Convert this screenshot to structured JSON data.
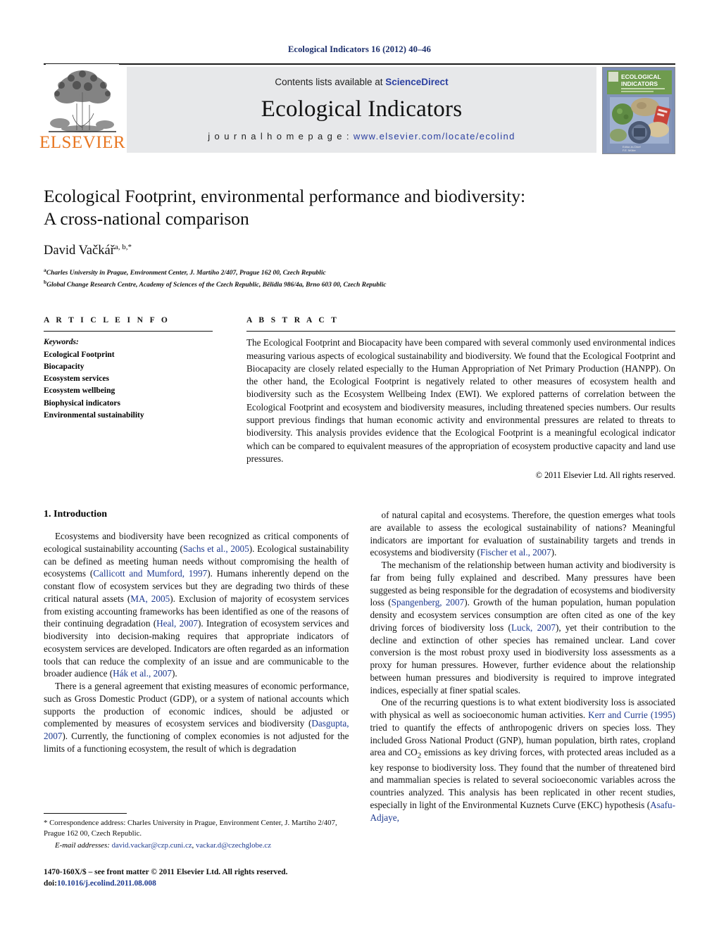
{
  "running_head": "Ecological Indicators 16 (2012) 40–46",
  "masthead": {
    "publisher_wordmark": "ELSEVIER",
    "contents_line_prefix": "Contents lists available at ",
    "contents_line_link": "ScienceDirect",
    "journal_title": "Ecological Indicators",
    "homepage_label": "j o u r n a l   h o m e p a g e :   ",
    "homepage_url": "www.elsevier.com/locate/ecolind",
    "cover": {
      "title_line1": "ECOLOGICAL",
      "title_line2": "INDICATORS",
      "subtitle": "INTEGRATING MONITORING ASSESSMENT AND MANAGEMENT"
    }
  },
  "article": {
    "title_line1": "Ecological Footprint, environmental performance and biodiversity:",
    "title_line2": "A cross-national comparison",
    "author": "David Vačkář",
    "author_marks": "a, b,*",
    "affiliation_a_mark": "a",
    "affiliation_a": "Charles University in Prague, Environment Center, J. Martího 2/407, Prague 162 00, Czech Republic",
    "affiliation_b_mark": "b",
    "affiliation_b": "Global Change Research Centre, Academy of Sciences of the Czech Republic, Bělidla 986/4a, Brno 603 00, Czech Republic"
  },
  "article_info": {
    "heading": "A R T I C L E   I N F O",
    "keywords_label": "Keywords:",
    "keywords": [
      "Ecological Footprint",
      "Biocapacity",
      "Ecosystem services",
      "Ecosystem wellbeing",
      "Biophysical indicators",
      "Environmental sustainability"
    ]
  },
  "abstract": {
    "heading": "A B S T R A C T",
    "text": "The Ecological Footprint and Biocapacity have been compared with several commonly used environmental indices measuring various aspects of ecological sustainability and biodiversity. We found that the Ecological Footprint and Biocapacity are closely related especially to the Human Appropriation of Net Primary Production (HANPP). On the other hand, the Ecological Footprint is negatively related to other measures of ecosystem health and biodiversity such as the Ecosystem Wellbeing Index (EWI). We explored patterns of correlation between the Ecological Footprint and ecosystem and biodiversity measures, including threatened species numbers. Our results support previous findings that human economic activity and environmental pressures are related to threats to biodiversity. This analysis provides evidence that the Ecological Footprint is a meaningful ecological indicator which can be compared to equivalent measures of the appropriation of ecosystem productive capacity and land use pressures.",
    "copyright": "© 2011 Elsevier Ltd. All rights reserved."
  },
  "sections": {
    "intro_heading": "1.  Introduction"
  },
  "left_column": {
    "para1_a": "Ecosystems and biodiversity have been recognized as critical components of ecological sustainability accounting (",
    "para1_cite1": "Sachs et al., 2005",
    "para1_b": "). Ecological sustainability can be defined as meeting human needs without compromising the health of ecosystems (",
    "para1_cite2": "Callicott and Mumford, 1997",
    "para1_c": "). Humans inherently depend on the constant flow of ecosystem services but they are degrading two thirds of these critical natural assets (",
    "para1_cite3": "MA, 2005",
    "para1_d": "). Exclusion of majority of ecosystem services from existing accounting frameworks has been identified as one of the reasons of their continuing degradation (",
    "para1_cite4": "Heal, 2007",
    "para1_e": "). Integration of ecosystem services and biodiversity into decision-making requires that appropriate indicators of ecosystem services are developed. Indicators are often regarded as an information tools that can reduce the complexity of an issue and are communicable to the broader audience (",
    "para1_cite5": "Hák et al., 2007",
    "para1_f": ").",
    "para2_a": "There is a general agreement that existing measures of economic performance, such as Gross Domestic Product (GDP), or a system of national accounts which supports the production of economic indices, should be adjusted or complemented by measures of ecosystem services and biodiversity (",
    "para2_cite1": "Dasgupta, 2007",
    "para2_b": "). Currently, the functioning of complex economies is not adjusted for the limits of a functioning ecosystem, the result of which is degradation"
  },
  "right_column": {
    "para1_a": "of natural capital and ecosystems. Therefore, the question emerges what tools are available to assess the ecological sustainability of nations? Meaningful indicators are important for evaluation of sustainability targets and trends in ecosystems and biodiversity (",
    "para1_cite1": "Fischer et al., 2007",
    "para1_b": ").",
    "para2_a": "The mechanism of the relationship between human activity and biodiversity is far from being fully explained and described. Many pressures have been suggested as being responsible for the degradation of ecosystems and biodiversity loss (",
    "para2_cite1": "Spangenberg, 2007",
    "para2_b": "). Growth of the human population, human population density and ecosystem services consumption are often cited as one of the key driving forces of biodiversity loss (",
    "para2_cite2": "Luck, 2007",
    "para2_c": "), yet their contribution to the decline and extinction of other species has remained unclear. Land cover conversion is the most robust proxy used in biodiversity loss assessments as a proxy for human pressures. However, further evidence about the relationship between human pressures and biodiversity is required to improve integrated indices, especially at finer spatial scales.",
    "para3_a": "One of the recurring questions is to what extent biodiversity loss is associated with physical as well as socioeconomic human activities. ",
    "para3_cite1": "Kerr and Currie (1995)",
    "para3_b": " tried to quantify the effects of anthropogenic drivers on species loss. They included Gross National Product (GNP), human population, birth rates, cropland area and CO",
    "para3_sub": "2",
    "para3_c": " emissions as key driving forces, with protected areas included as a key response to biodiversity loss. They found that the number of threatened bird and mammalian species is related to several socioeconomic variables across the countries analyzed. This analysis has been replicated in other recent studies, especially in light of the Environmental Kuznets Curve (EKC) hypothesis (",
    "para3_cite2": "Asafu-Adjaye,"
  },
  "footnotes": {
    "correspondence_mark": "*",
    "correspondence": " Correspondence address: Charles University in Prague, Environment Center, J. Martího 2/407, Prague 162 00, Czech Republic.",
    "email_label": "E-mail addresses:",
    "email_1": "david.vackar@czp.cuni.cz",
    "email_sep": ", ",
    "email_2": "vackar.d@czechglobe.cz",
    "imprint_line": "1470-160X/$ – see front matter © 2011 Elsevier Ltd. All rights reserved.",
    "doi_label": "doi:",
    "doi_value": "10.1016/j.ecolind.2011.08.008"
  },
  "colors": {
    "running_head": "#1a2d6b",
    "elsevier_orange": "#E87722",
    "link_blue": "#1e3a8f",
    "banner_bg": "#e7e8ea",
    "cover_green": "#6f9b4e"
  }
}
